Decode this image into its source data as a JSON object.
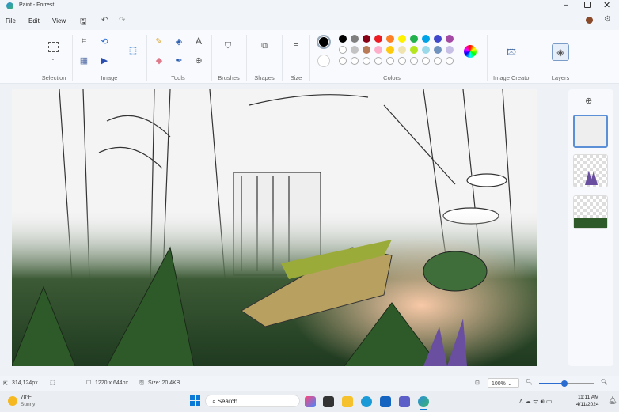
{
  "window": {
    "title": "Paint - Forrest"
  },
  "menu": {
    "file": "File",
    "edit": "Edit",
    "view": "View"
  },
  "ribbon": {
    "groups": [
      "Selection",
      "Image",
      "Tools",
      "Brushes",
      "Shapes",
      "Size",
      "Colors",
      "Image Creator",
      "Layers"
    ]
  },
  "colors": {
    "primary": "#000000",
    "secondary": "#ffffff",
    "row1": [
      "#000000",
      "#7f7f7f",
      "#880015",
      "#ed1c24",
      "#ff7f27",
      "#fff200",
      "#22b14c",
      "#00a2e8",
      "#3f48cc",
      "#a349a4"
    ],
    "row2": [
      "#ffffff",
      "#c3c3c3",
      "#b97a57",
      "#ffaec9",
      "#ffc90e",
      "#efe4b0",
      "#b5e61d",
      "#99d9ea",
      "#7092be",
      "#c8bfe7"
    ]
  },
  "status": {
    "cursor": "314,124px",
    "dimensions": "1220 x 644px",
    "size": "Size: 20.4KB",
    "zoom": "100%",
    "zoom_level": 0.45
  },
  "taskbar": {
    "temp": "78°F",
    "weather": "Sunny",
    "search": "Search",
    "time": "11:11 AM",
    "date": "4/11/2024"
  }
}
